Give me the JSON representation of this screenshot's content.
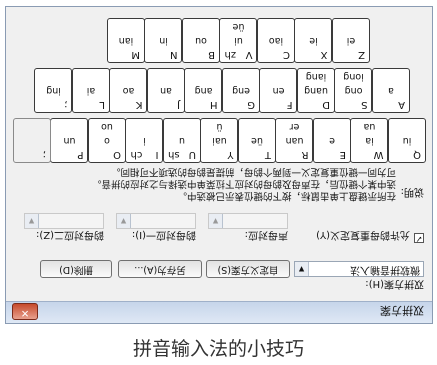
{
  "window": {
    "title": "双拼方案",
    "close_glyph": "✕"
  },
  "scheme": {
    "label": "双拼方案(H):",
    "selected": "微软拼音输入法",
    "custom_button": "自定义方案(S)",
    "save_as_button": "另存为(A)...",
    "delete_button": "删除(D)"
  },
  "options": {
    "allow_redefine_label": "允许韵母重复定义(Y)",
    "allow_redefine_checked": "✓",
    "initial_label": "声母对应:",
    "final1_label": "韵母对应一(I):",
    "final2_label": "韵母对应二(Z):"
  },
  "note": {
    "label": "说明:",
    "lines": [
      "在所示键盘上单击鼠标，按下的键位表示已被选中。",
      "选中某个键位后，在声母及韵母的对应下拉菜单中选择与之对应的拼音。",
      "可为同一键位重复定义一到两个韵母，前提是韵母的选项不可相同。"
    ]
  },
  "keyboard": {
    "rows": [
      [
        {
          "key": "Q",
          "y": "",
          "f1": "iu",
          "f2": ""
        },
        {
          "key": "W",
          "y": "",
          "f1": "ia",
          "f2": "ua"
        },
        {
          "key": "E",
          "y": "",
          "f1": "e",
          "f2": ""
        },
        {
          "key": "R",
          "y": "",
          "f1": "uan",
          "f2": "er"
        },
        {
          "key": "T",
          "y": "",
          "f1": "üe",
          "f2": ""
        },
        {
          "key": "Y",
          "y": "",
          "f1": "uai",
          "f2": "ü"
        },
        {
          "key": "U",
          "y": "sh",
          "f1": "u",
          "f2": ""
        },
        {
          "key": "I",
          "y": "ch",
          "f1": "i",
          "f2": ""
        },
        {
          "key": "O",
          "y": "",
          "f1": "o",
          "f2": "uo"
        },
        {
          "key": "P",
          "y": "",
          "f1": "un",
          "f2": ""
        },
        {
          "key": ";",
          "y": "",
          "f1": "",
          "f2": ""
        }
      ],
      [
        {
          "key": "A",
          "y": "",
          "f1": "a",
          "f2": ""
        },
        {
          "key": "S",
          "y": "",
          "f1": "ong",
          "f2": "iong"
        },
        {
          "key": "D",
          "y": "",
          "f1": "uang",
          "f2": "iang"
        },
        {
          "key": "F",
          "y": "",
          "f1": "en",
          "f2": ""
        },
        {
          "key": "G",
          "y": "",
          "f1": "eng",
          "f2": ""
        },
        {
          "key": "H",
          "y": "",
          "f1": "ang",
          "f2": ""
        },
        {
          "key": "J",
          "y": "",
          "f1": "an",
          "f2": ""
        },
        {
          "key": "K",
          "y": "",
          "f1": "ao",
          "f2": ""
        },
        {
          "key": "L",
          "y": "",
          "f1": "ai",
          "f2": ""
        },
        {
          "key": ";",
          "y": "",
          "f1": "ing",
          "f2": ""
        }
      ],
      [
        {
          "key": "Z",
          "y": "",
          "f1": "ei",
          "f2": ""
        },
        {
          "key": "X",
          "y": "",
          "f1": "ie",
          "f2": ""
        },
        {
          "key": "C",
          "y": "",
          "f1": "iao",
          "f2": ""
        },
        {
          "key": "V",
          "y": "zh",
          "f1": "ui",
          "f2": "üe"
        },
        {
          "key": "B",
          "y": "",
          "f1": "ou",
          "f2": ""
        },
        {
          "key": "N",
          "y": "",
          "f1": "in",
          "f2": ""
        },
        {
          "key": "M",
          "y": "",
          "f1": "ian",
          "f2": ""
        }
      ]
    ]
  },
  "caption": "拼音输入法的小技巧"
}
